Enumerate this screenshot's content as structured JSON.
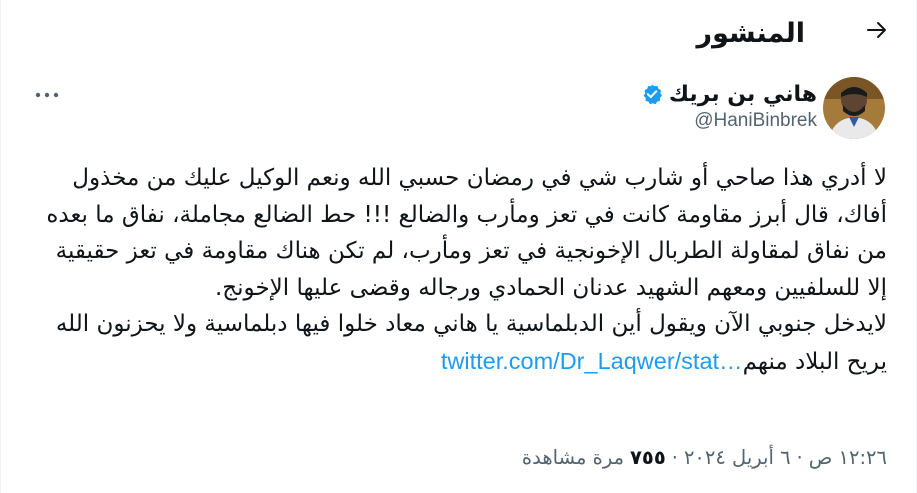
{
  "header": {
    "title": "المنشور",
    "back_icon": "arrow-right-icon"
  },
  "author": {
    "display_name": "هاني بن بريك",
    "handle": "@HaniBinbrek",
    "verified": true,
    "verified_color": "#1d9bf0",
    "avatar_icon": "profile-photo"
  },
  "tweet": {
    "text": "لا أدري هذا صاحي أو شارب شي في رمضان حسبي الله ونعم الوكيل عليك من مخذول أفاك، قال أبرز مقاومة كانت في تعز ومأرب والضالع !!! حط الضالع مجاملة، نفاق ما بعده من نفاق لمقاولة الطربال الإخونجية في تعز ومأرب، لم تكن هناك مقاومة في تعز حقيقية إلا للسلفيين ومعهم الشهيد عدنان الحمادي ورجاله وقضى عليها الإخونج.\nلايدخل جنوبي الآن ويقول أين الدبلماسية يا هاني معاد خلوا فيها دبلماسية ولا يحزنون الله يريح البلاد منهم",
    "link": "twitter.com/Dr_Laqwer/stat…",
    "link_color": "#1d9bf0"
  },
  "meta": {
    "time": "١٢:٢٦ ص",
    "date": "٦ أبريل ٢٠٢٤",
    "separator": "·",
    "views_count": "٧٥٥",
    "views_label": "مرة مشاهدة"
  }
}
